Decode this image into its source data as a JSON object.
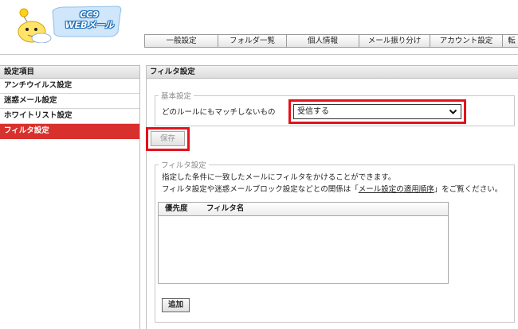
{
  "logo": {
    "line1": "CC9",
    "line2": "WEBメール"
  },
  "tabs": [
    {
      "label": "一般設定"
    },
    {
      "label": "フォルダ一覧"
    },
    {
      "label": "個人情報"
    },
    {
      "label": "メール振り分け"
    },
    {
      "label": "アカウント設定"
    },
    {
      "label": "転"
    }
  ],
  "sidebar": {
    "heading": "設定項目",
    "items": [
      {
        "label": "アンチウイルス設定",
        "active": false
      },
      {
        "label": "迷惑メール設定",
        "active": false
      },
      {
        "label": "ホワイトリスト設定",
        "active": false
      },
      {
        "label": "フィルタ設定",
        "active": true
      }
    ]
  },
  "main": {
    "heading": "フィルタ設定",
    "basic": {
      "legend": "基本設定",
      "rule_label": "どのルールにもマッチしないもの",
      "select_value": "受信する",
      "save_label": "保存"
    },
    "filter": {
      "legend": "フィルタ設定",
      "desc1": "指定した条件に一致したメールにフィルタをかけることができます。",
      "desc2_pre": "フィルタ設定や迷惑メールブロック設定などとの関係は「",
      "desc2_link": "メール設定の適用順序",
      "desc2_post": "」をご覧ください。",
      "columns": {
        "priority": "優先度",
        "name": "フィルタ名"
      },
      "add_label": "追加"
    }
  },
  "colors": {
    "active_sidebar": "#d8302c",
    "highlight": "#e3121b",
    "logo_blue": "#1e6fb8"
  }
}
